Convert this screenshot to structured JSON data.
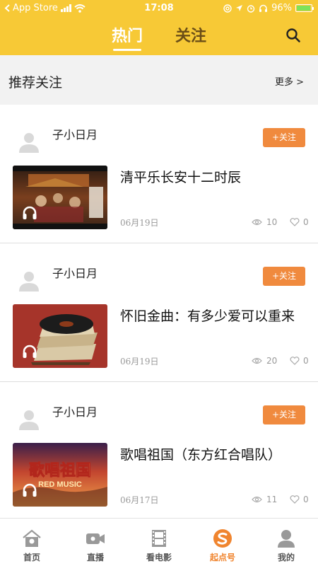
{
  "status_bar": {
    "carrier": "App Store",
    "time": "17:08",
    "battery_percent": "96%",
    "battery_level": 0.96,
    "icons": [
      "back-arrow-icon",
      "signal-icon",
      "wifi-icon",
      "at-icon",
      "location-icon",
      "alarm-icon",
      "headphones-icon",
      "battery-charging-icon"
    ]
  },
  "header": {
    "tabs": [
      {
        "label": "热门",
        "active": true
      },
      {
        "label": "关注",
        "active": false
      }
    ],
    "search_icon": "search-icon",
    "colors": {
      "background": "#f7c936",
      "inactive_tab": "#6b4e17",
      "active_tab": "#ffffff"
    }
  },
  "recommend": {
    "title": "推荐关注",
    "more_label": "更多 >"
  },
  "feed": [
    {
      "author": "子小日月",
      "follow_label": "+关注",
      "title": "清平乐长安十二时辰",
      "date": "06月19日",
      "views": "10",
      "likes": "0",
      "thumb_icon": "headphones-icon"
    },
    {
      "author": "子小日月",
      "follow_label": "+关注",
      "title": "怀旧金曲：有多少爱可以重来",
      "date": "06月19日",
      "views": "20",
      "likes": "0",
      "thumb_icon": "headphones-icon"
    },
    {
      "author": "子小日月",
      "follow_label": "+关注",
      "title": "歌唱祖国（东方红合唱队）",
      "date": "06月17日",
      "views": "11",
      "likes": "0",
      "thumb_icon": "headphones-icon",
      "thumb_text": [
        "歌唱祖国",
        "RED MUSIC"
      ]
    }
  ],
  "bottom_nav": [
    {
      "label": "首页",
      "icon": "home-icon",
      "active": false
    },
    {
      "label": "直播",
      "icon": "video-camera-icon",
      "active": false
    },
    {
      "label": "看电影",
      "icon": "film-icon",
      "active": false
    },
    {
      "label": "起点号",
      "icon": "qidian-s-icon",
      "active": true
    },
    {
      "label": "我的",
      "icon": "user-icon",
      "active": false
    }
  ],
  "colors": {
    "accent": "#f08a3e",
    "active_nav": "#f0852f",
    "muted": "#999999"
  }
}
